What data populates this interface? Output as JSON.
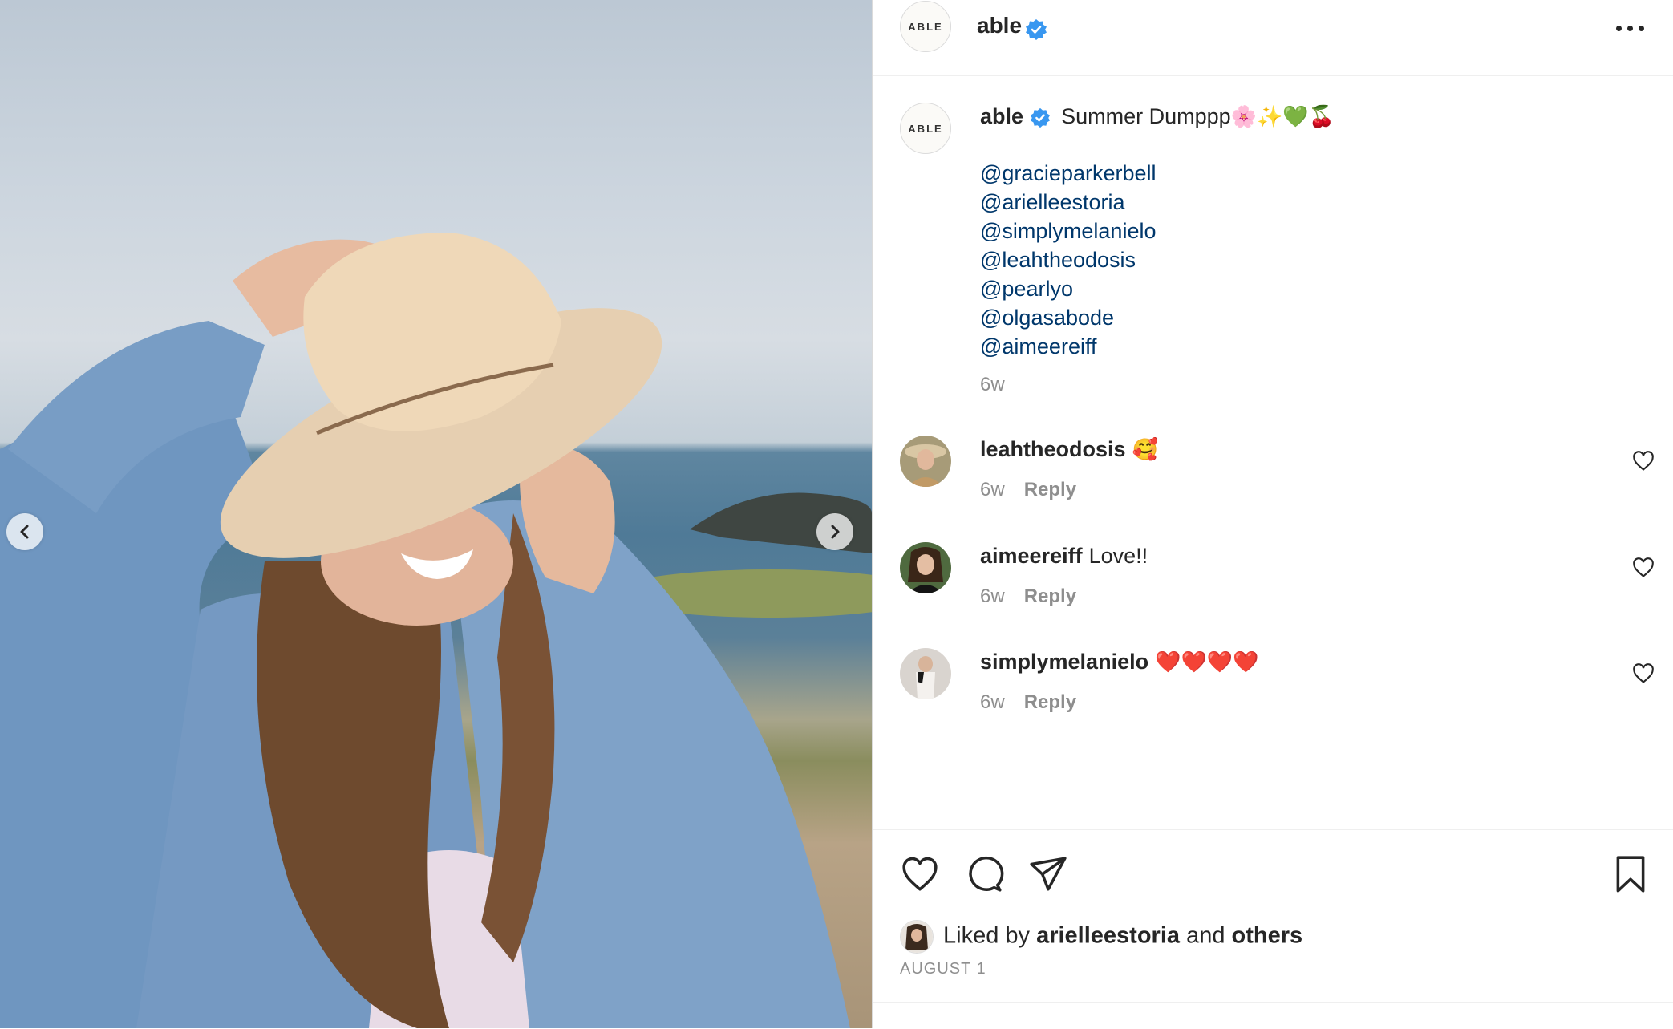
{
  "post": {
    "author": "able",
    "avatar_text": "ABLE",
    "caption_text": "Summer Dumppp",
    "caption_emoji": "🌸✨💚🍒",
    "mentions": [
      "@gracieparkerbell",
      "@arielleestoria",
      "@simplymelanielo",
      "@leahtheodosis",
      "@pearlyo",
      "@olgasabode",
      "@aimeereiff"
    ],
    "time_ago": "6w"
  },
  "comments": [
    {
      "user": "leahtheodosis",
      "text": "🥰",
      "time": "6w",
      "reply": "Reply"
    },
    {
      "user": "aimeereiff",
      "text": "Love!!",
      "time": "6w",
      "reply": "Reply"
    },
    {
      "user": "simplymelanielo",
      "text": "❤️❤️❤️❤️",
      "time": "6w",
      "reply": "Reply"
    }
  ],
  "likes": {
    "prefix": "Liked by",
    "user": "arielleestoria",
    "joiner": "and",
    "others": "others"
  },
  "date": "AUGUST 1",
  "icons": {
    "more": "more-options-icon",
    "verified": "verified-badge-icon",
    "prev": "chevron-left-icon",
    "next": "chevron-right-icon",
    "like": "heart-icon",
    "comment": "comment-icon",
    "share": "send-icon",
    "save": "bookmark-icon"
  },
  "colors": {
    "verified": "#3897f0",
    "mention": "#00376b",
    "secondary_text": "#8e8e8e",
    "heart_red": "#ed4956"
  }
}
